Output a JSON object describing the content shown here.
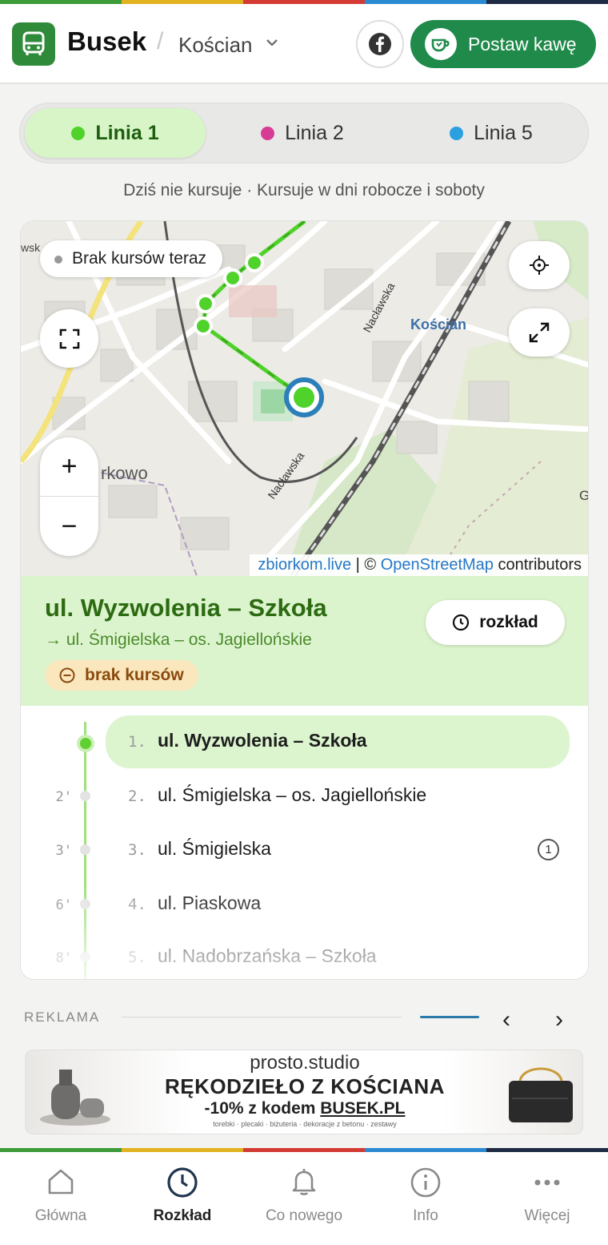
{
  "header": {
    "brand": "Busek",
    "separator": "/",
    "city": "Kościan",
    "coffee_label": "Postaw kawę"
  },
  "tabs": [
    {
      "label": "Linia 1",
      "color": "#4fd22a",
      "active": true
    },
    {
      "label": "Linia 2",
      "color": "#d63c95",
      "active": false
    },
    {
      "label": "Linia 5",
      "color": "#2aa0e0",
      "active": false
    }
  ],
  "status_line": "Dziś nie kursuje · Kursuje w dni robocze i soboty",
  "map": {
    "status_pill": "Brak kursów teraz",
    "zoom_in": "+",
    "zoom_out": "−",
    "labels": {
      "city": "Kościan",
      "street1": "Nacławska",
      "street2": "Nacławska",
      "place": "rkowo",
      "edge": "G",
      "edge2": "wsk"
    },
    "attribution": {
      "link1": "zbiorkom.live",
      "sep": " | © ",
      "link2": "OpenStreetMap",
      "suffix": " contributors"
    }
  },
  "stop": {
    "name": "ul. Wyzwolenia – Szkoła",
    "direction": "→ ul. Śmigielska – os. Jagiellońskie",
    "badge": "brak kursów",
    "schedule_button": "rozkład"
  },
  "stops": [
    {
      "min": "",
      "num": "1.",
      "name": "ul. Wyzwolenia – Szkoła",
      "active": true
    },
    {
      "min": "2'",
      "num": "2.",
      "name": "ul. Śmigielska – os. Jagiellońskie"
    },
    {
      "min": "3'",
      "num": "3.",
      "name": "ul. Śmigielska",
      "info": "1"
    },
    {
      "min": "6'",
      "num": "4.",
      "name": "ul. Piaskowa"
    },
    {
      "min": "8'",
      "num": "5.",
      "name": "ul. Nadobrzańska – Szkoła"
    }
  ],
  "ads": {
    "label": "REKLAMA",
    "prev": "‹",
    "next": "›",
    "studio": "prosto.studio",
    "title": "RĘKODZIEŁO Z KOŚCIANA",
    "code_prefix": "-10% z kodem ",
    "code": "BUSEK.PL",
    "small": "torebki · plecaki · biżuteria · dekoracje z betonu · zestawy"
  },
  "nav": [
    {
      "label": "Główna",
      "icon": "home-icon"
    },
    {
      "label": "Rozkład",
      "icon": "clock-icon",
      "active": true
    },
    {
      "label": "Co nowego",
      "icon": "bell-icon"
    },
    {
      "label": "Info",
      "icon": "info-icon"
    },
    {
      "label": "Więcej",
      "icon": "more-icon"
    }
  ],
  "colors": {
    "brand_green": "#2f8a3a",
    "coffee_green": "#1f8a4a",
    "route_green": "#4fd22a",
    "stop_panel": "#dbf4cd"
  }
}
